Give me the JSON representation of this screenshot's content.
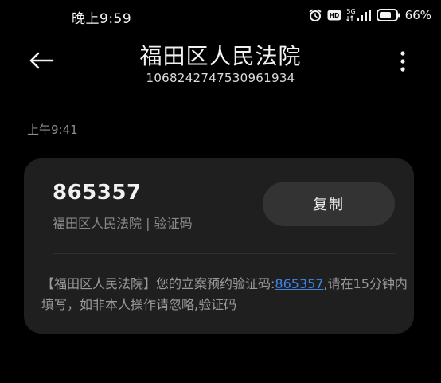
{
  "status_bar": {
    "time": "晚上9:59",
    "network": "5G",
    "battery": "66%"
  },
  "header": {
    "title": "福田区人民法院",
    "subtitle": "1068242747530961934"
  },
  "message": {
    "timestamp": "上午9:41",
    "code": "865357",
    "source": "福田区人民法院 | 验证码",
    "copy_label": "复制",
    "body_prefix": "【福田区人民法院】您的立案预约验证码:",
    "body_code": "865357",
    "body_suffix": ",请在15分钟内填写，如非本人操作请忽略,验证码"
  },
  "icons": {
    "back": "arrow-left-icon",
    "more": "more-vertical-icon",
    "alarm": "alarm-clock-icon",
    "hd": "hd-icon",
    "signal": "signal-icon",
    "battery": "battery-icon"
  }
}
